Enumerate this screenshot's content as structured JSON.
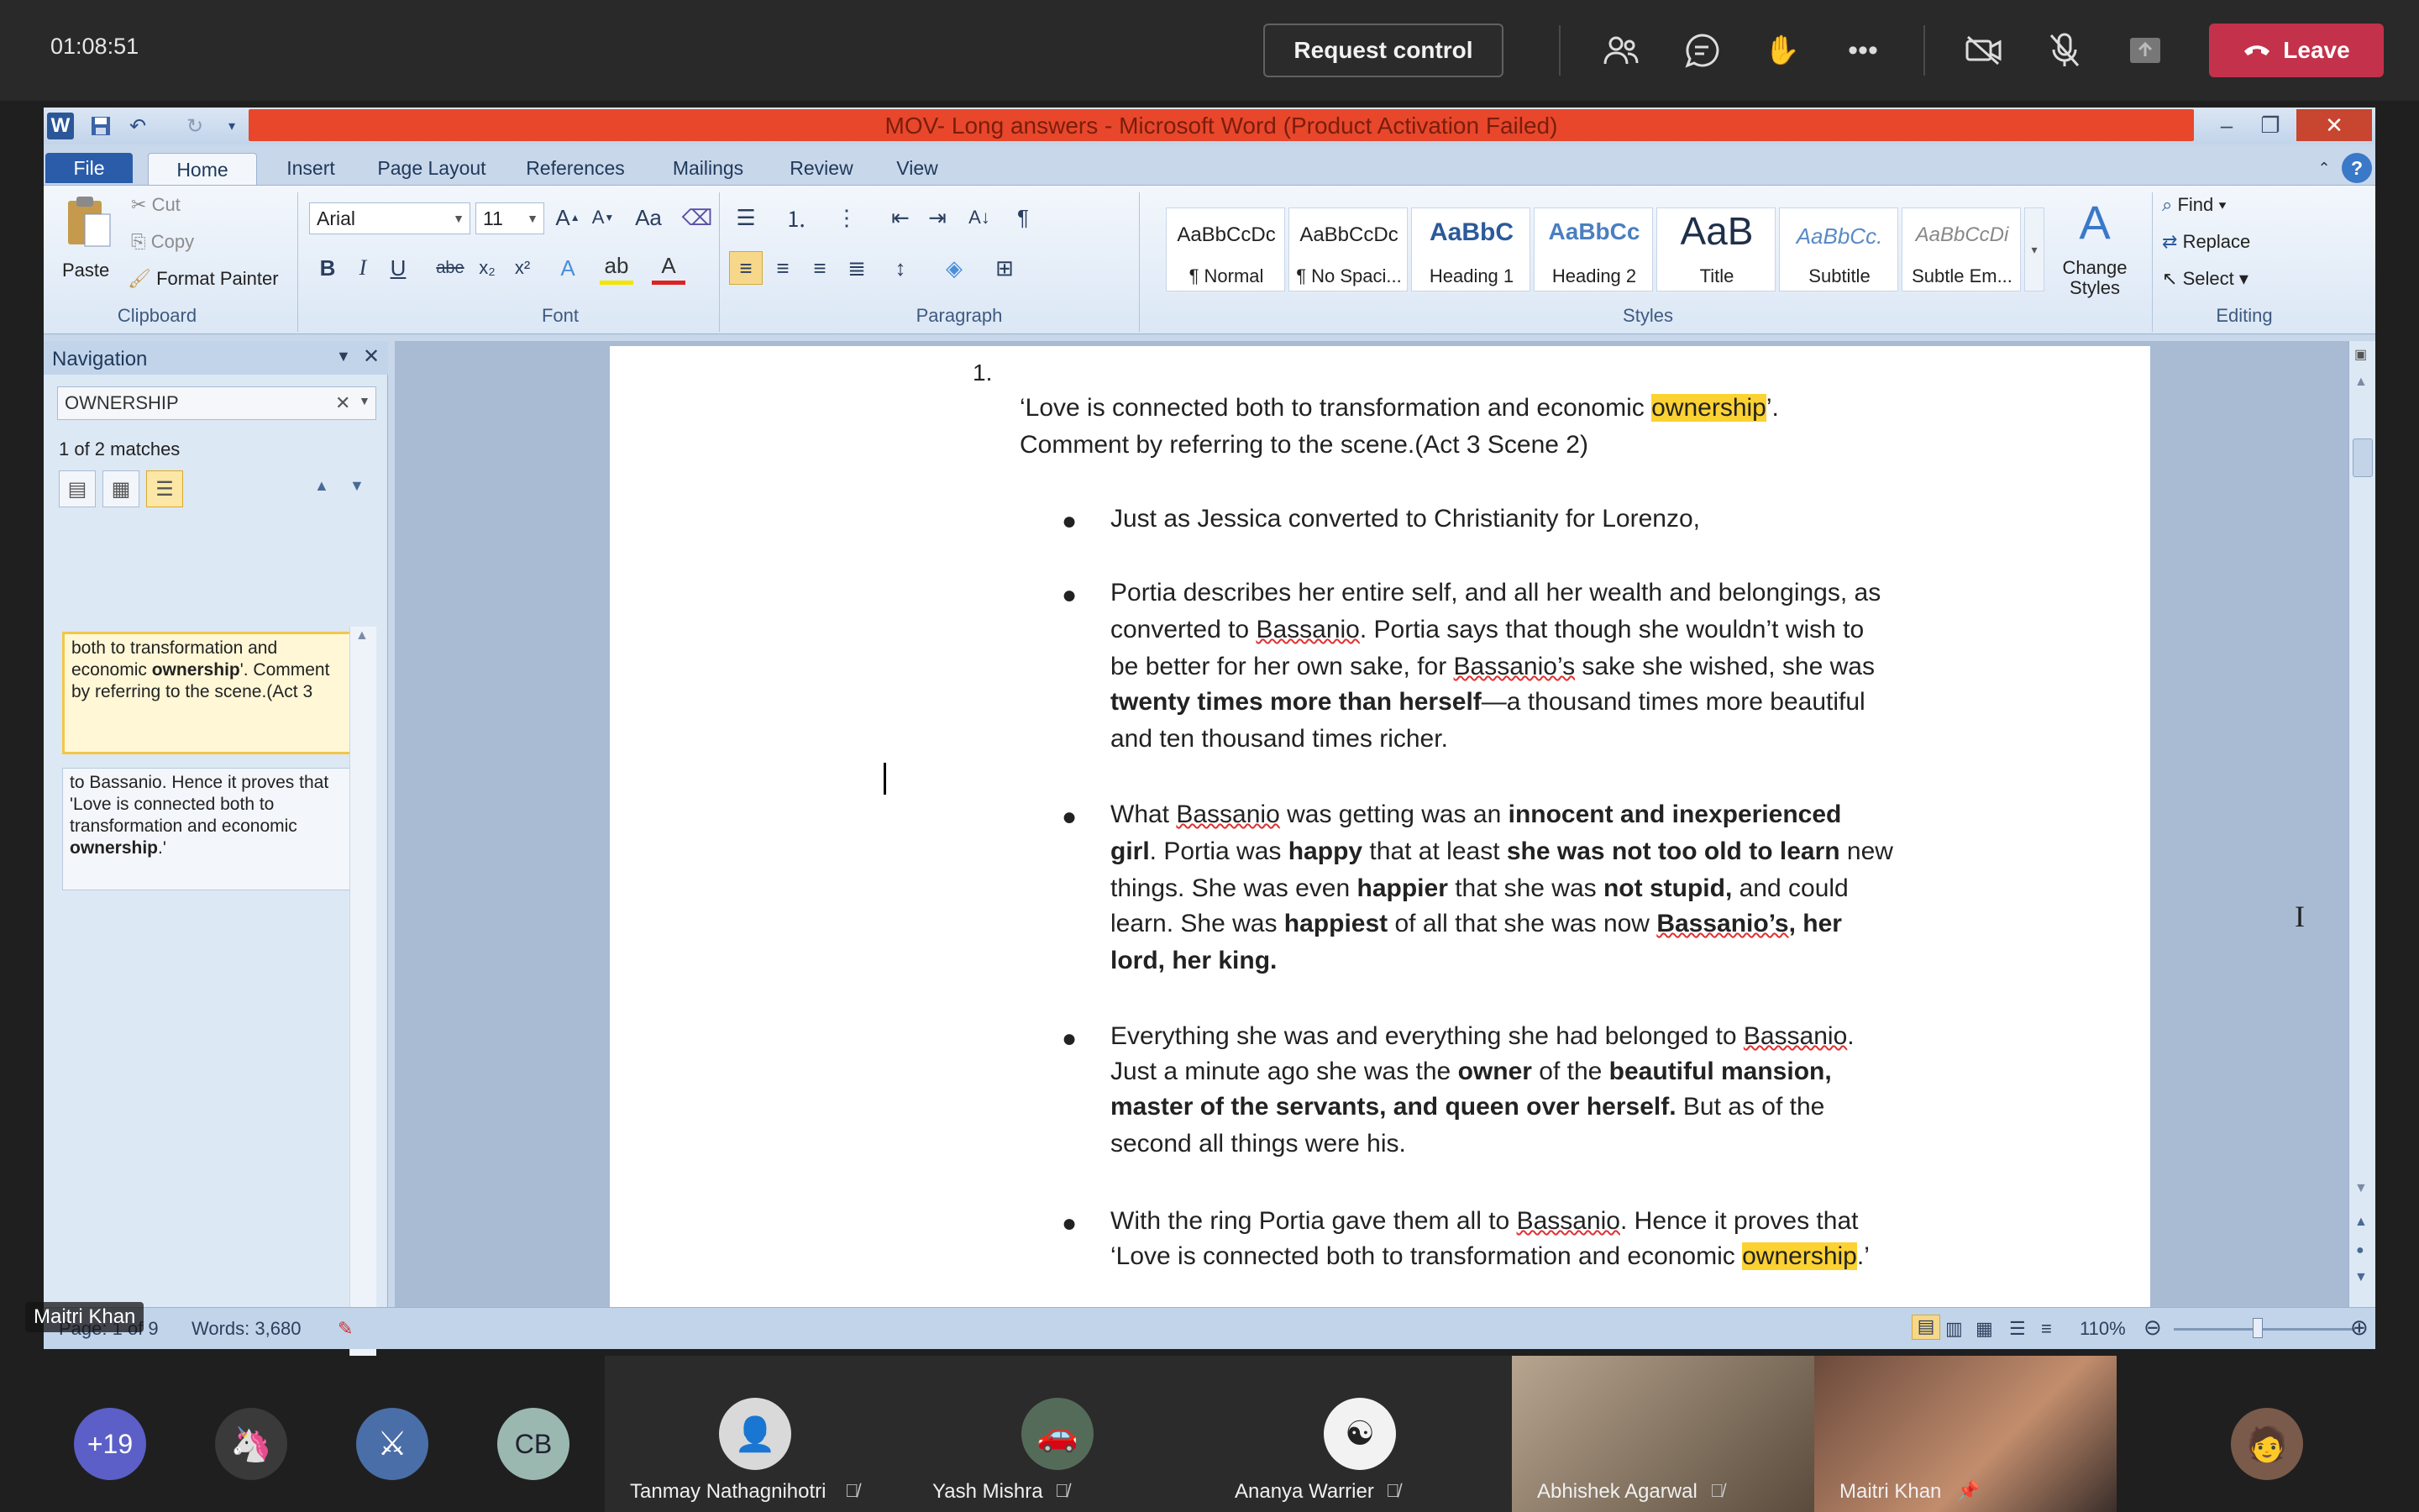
{
  "teams": {
    "timer": "01:08:51",
    "request_control": "Request control",
    "leave": "Leave",
    "presenter_label": "Maitri Khan"
  },
  "word": {
    "window_title": "MOV- Long answers - Microsoft Word (Product Activation Failed)",
    "tabs": [
      "File",
      "Home",
      "Insert",
      "Page Layout",
      "References",
      "Mailings",
      "Review",
      "View"
    ],
    "clipboard": {
      "paste": "Paste",
      "cut": "Cut",
      "copy": "Copy",
      "format_painter": "Format Painter",
      "label": "Clipboard"
    },
    "font": {
      "name": "Arial",
      "size": "11",
      "label": "Font"
    },
    "paragraph_label": "Paragraph",
    "styles": [
      {
        "sample": "AaBbCcDc",
        "name": "¶ Normal"
      },
      {
        "sample": "AaBbCcDc",
        "name": "¶ No Spaci..."
      },
      {
        "sample": "AaBbC",
        "name": "Heading 1"
      },
      {
        "sample": "AaBbCc",
        "name": "Heading 2"
      },
      {
        "sample": "AaB",
        "name": "Title"
      },
      {
        "sample": "AaBbCc.",
        "name": "Subtitle"
      },
      {
        "sample": "AaBbCcDi",
        "name": "Subtle Em..."
      }
    ],
    "styles_label": "Styles",
    "change_styles": "Change Styles",
    "editing": {
      "find": "Find",
      "replace": "Replace",
      "select": "Select",
      "label": "Editing"
    },
    "navigation": {
      "title": "Navigation",
      "search_value": "OWNERSHIP",
      "matches": "1 of 2 matches",
      "result1_a": "both to transformation and economic ",
      "result1_bold": "ownership",
      "result1_b": "'. Comment by referring to the scene.(Act 3",
      "result2_a": "to Bassanio. Hence it proves that 'Love is connected both to transformation and economic ",
      "result2_bold": "ownership",
      "result2_b": ".'"
    },
    "document": {
      "number": "1.",
      "q_line1_a": "‘Love is connected both to transformation and economic ",
      "q_line1_hl": "ownership",
      "q_line1_b": "’.",
      "q_line2": "Comment by referring to the scene.(Act 3 Scene 2)",
      "b1": "Just as Jessica converted to Christianity for Lorenzo,",
      "b2_l1": "Portia describes her entire self, and all her wealth and belongings, as",
      "b2_l2a": "converted to ",
      "b2_l2b": "Bassanio",
      "b2_l2c": ". Portia says that though she wouldn’t wish to",
      "b2_l3a": "be better for her own sake, for ",
      "b2_l3b": "Bassanio’s",
      "b2_l3c": " sake she wished, she was",
      "b2_l4a": "twenty times more than herself",
      "b2_l4b": "—a thousand times more beautiful",
      "b2_l5": "and ten thousand times richer.",
      "b3_l1a": "What ",
      "b3_l1b": "Bassanio",
      "b3_l1c": " was getting was an ",
      "b3_l1d": "innocent and inexperienced",
      "b3_l2a": "girl",
      "b3_l2b": ". Portia was ",
      "b3_l2c": "happy",
      "b3_l2d": " that at least ",
      "b3_l2e": "she was not too old to learn",
      "b3_l2f": " new",
      "b3_l3a": "things. She was even ",
      "b3_l3b": "happier",
      "b3_l3c": " that she was ",
      "b3_l3d": "not stupid,",
      "b3_l3e": " and could",
      "b3_l4a": "learn. She was ",
      "b3_l4b": "happiest",
      "b3_l4c": " of all that she was now ",
      "b3_l4d": "Bassanio’s",
      "b3_l4e": ", her",
      "b3_l5": "lord, her king.",
      "b4_l1a": "Everything she was and everything she had belonged to ",
      "b4_l1b": "Bassanio",
      "b4_l1c": ".",
      "b4_l2a": "Just a minute ago she was the ",
      "b4_l2b": "owner",
      "b4_l2c": " of the ",
      "b4_l2d": "beautiful mansion,",
      "b4_l3a": "master of the servants, and queen over herself.",
      "b4_l3b": " But as of the",
      "b4_l4": "second all things were his.",
      "b5_l1a": "With the ring Portia gave them all to ",
      "b5_l1b": "Bassanio",
      "b5_l1c": ". Hence it proves that",
      "b5_l2a": "‘Love is connected both to transformation and economic ",
      "b5_l2b": "ownership",
      "b5_l2c": ".’"
    },
    "status": {
      "page": "Page: 1 of 9",
      "words": "Words: 3,680",
      "zoom": "110%"
    }
  },
  "participants": {
    "overflow": "+19",
    "initials": "CB",
    "names": [
      "Tanmay Nathagnihotri",
      "Yash Mishra",
      "Ananya Warrier",
      "Abhishek Agarwal",
      "Maitri Khan"
    ]
  }
}
